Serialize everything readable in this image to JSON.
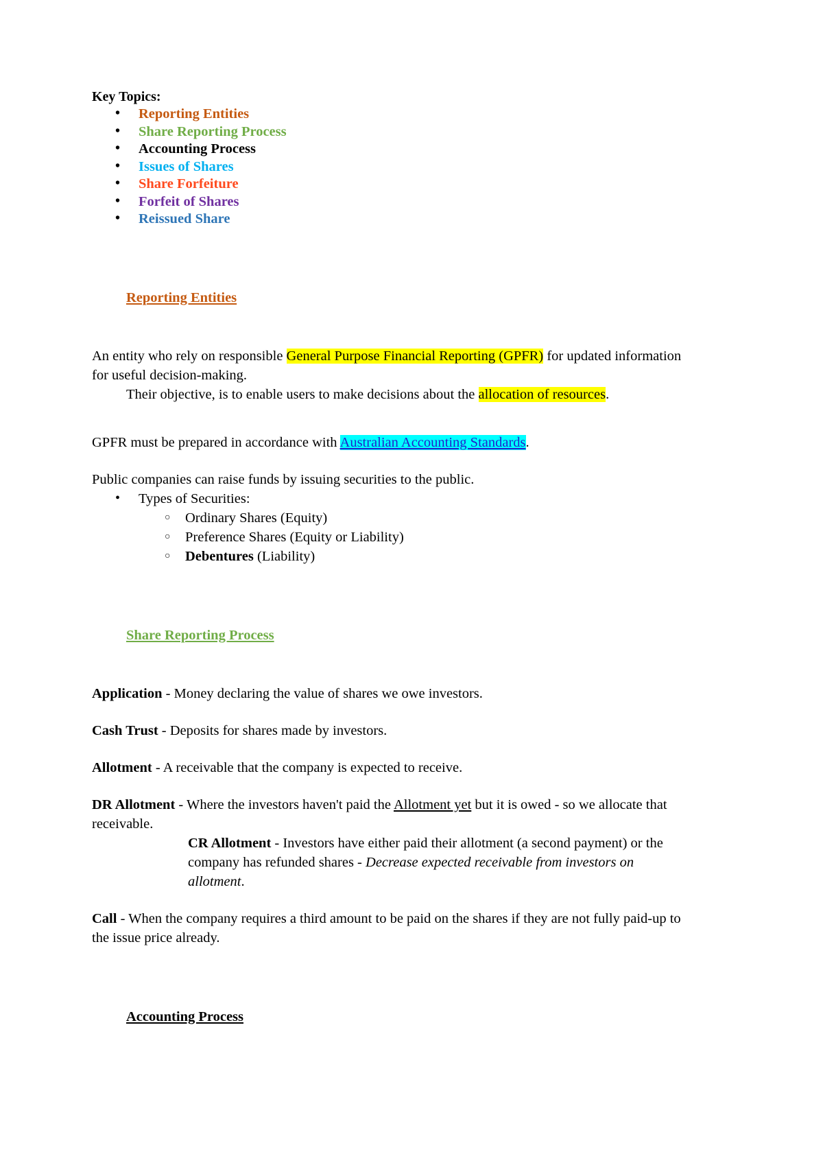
{
  "document": {
    "key_topics_title": "Key Topics:",
    "topics": [
      {
        "label": "Reporting Entities",
        "color": "#c55a11"
      },
      {
        "label": "Share Reporting Process",
        "color": "#70ad47"
      },
      {
        "label": "Accounting Process",
        "color": "#000000"
      },
      {
        "label": "Issues of Shares",
        "color": "#00b0f0"
      },
      {
        "label": "Share Forfeiture",
        "color": "#ff4a1e"
      },
      {
        "label": "Forfeit of Shares",
        "color": "#7030a0"
      },
      {
        "label": "Reissued Share",
        "color": "#2e75b6"
      }
    ],
    "section1": {
      "heading": "Reporting Entities",
      "heading_color": "#c55a11",
      "para1_part1": "An entity who rely on responsible ",
      "para1_highlight": "General Purpose Financial Reporting (GPFR)",
      "para1_part2": " for updated information for useful decision-making.",
      "para2_part1": "Their objective, is to enable users to make decisions about the ",
      "para2_highlight": "allocation of resources",
      "para2_part2": ".",
      "para3_part1": "GPFR must be prepared in accordance with ",
      "para3_highlight": "Australian Accounting Standards",
      "para3_part2": ".",
      "para4": "Public companies can raise funds by issuing securities to the public.",
      "securities_label": "Types of Securities:",
      "securities": [
        {
          "bold": "",
          "rest": "Ordinary Shares (Equity)"
        },
        {
          "bold": "",
          "rest": "Preference Shares (Equity or Liability)"
        },
        {
          "bold": "Debentures",
          "rest": " (Liability)"
        }
      ]
    },
    "section2": {
      "heading": "Share Reporting Process",
      "heading_color": "#70ad47",
      "definitions": [
        {
          "term": "Application",
          "body": " - Money declaring the value of shares we owe investors."
        },
        {
          "term": "Cash Trust",
          "body": " - Deposits for shares made by investors."
        },
        {
          "term": "Allotment",
          "body": " - A receivable that the company is expected to receive."
        }
      ],
      "dr_term": "DR Allotment",
      "dr_body_1": " - Where the investors haven't paid the ",
      "dr_underlined": "Allotment yet",
      "dr_body_2": " but it is owed - so we allocate that receivable.",
      "cr_term": "CR Allotment",
      "cr_body_1": " - Investors have either paid their allotment (a second payment) or the company has refunded shares - ",
      "cr_italic": "Decrease expected receivable from investors on allotment",
      "cr_body_2": ".",
      "call_term": "Call",
      "call_body": " - When the company requires a third amount to be paid on the shares if they are not fully paid-up to the issue price already."
    },
    "section3": {
      "heading": "Accounting Process",
      "heading_color": "#000000"
    }
  }
}
